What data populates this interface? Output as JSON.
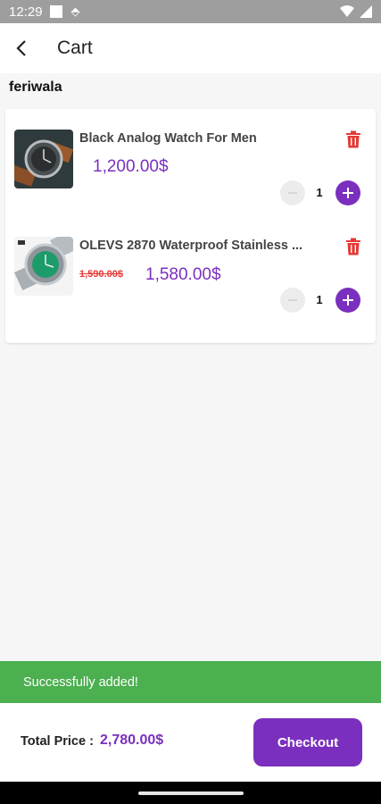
{
  "status_bar": {
    "time": "12:29"
  },
  "app_bar": {
    "title": "Cart"
  },
  "store": {
    "name": "feriwala"
  },
  "cart": {
    "items": [
      {
        "name": "Black Analog Watch For Men",
        "price": "1,200.00$",
        "old_price": "",
        "quantity": "1",
        "thumbnail": "black-leather-watch"
      },
      {
        "name": "OLEVS 2870 Waterproof Stainless ...",
        "price": "1,580.00$",
        "old_price": "1,590.00$",
        "quantity": "1",
        "thumbnail": "green-dial-steel-watch"
      }
    ]
  },
  "snackbar": {
    "message": "Successfully added!"
  },
  "footer": {
    "total_label": "Total Price :",
    "total_value": "2,780.00$",
    "checkout_label": "Checkout"
  },
  "colors": {
    "accent": "#7b2fbe",
    "delete": "#e53935",
    "snackbar": "#4caf50",
    "status_bar": "#9e9e9e"
  }
}
